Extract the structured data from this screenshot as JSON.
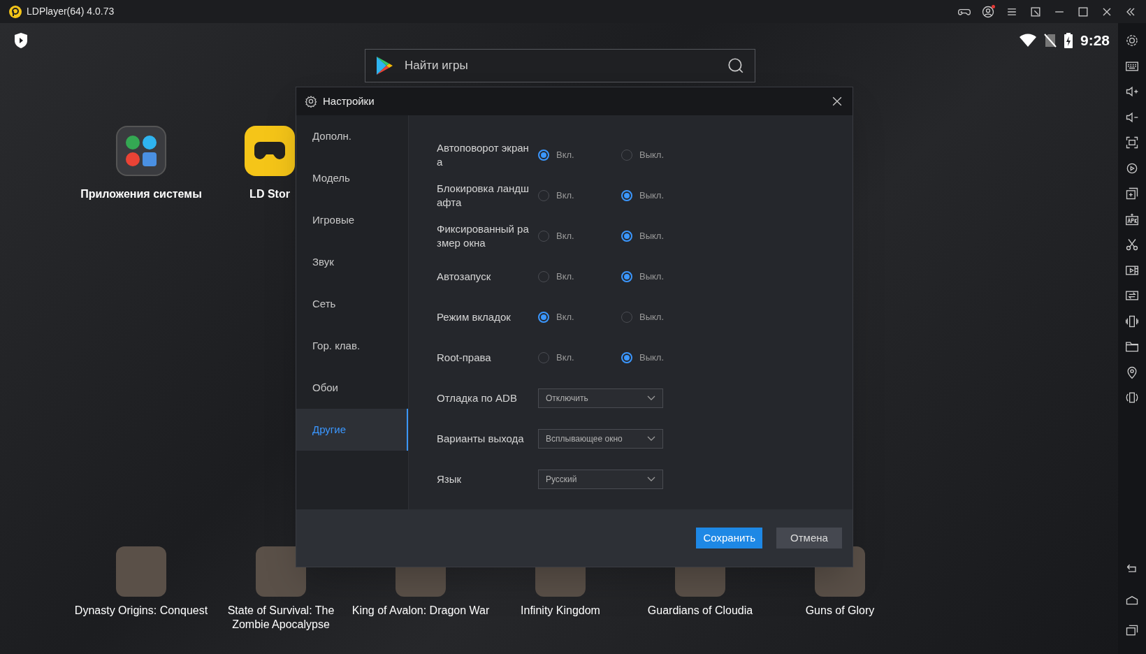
{
  "window": {
    "title": "LDPlayer(64) 4.0.73"
  },
  "status_bar": {
    "time": "9:28"
  },
  "search": {
    "placeholder": "Найти игры"
  },
  "desktop_icons": [
    {
      "label": "Приложения системы",
      "kind": "folder"
    },
    {
      "label": "LD Stor",
      "kind": "store"
    }
  ],
  "dock_apps": [
    {
      "label": "Dynasty Origins: Conquest"
    },
    {
      "label": "State of Survival: The Zombie Apocalypse"
    },
    {
      "label": "King of Avalon: Dragon War"
    },
    {
      "label": "Infinity Kingdom"
    },
    {
      "label": "Guardians of Cloudia"
    },
    {
      "label": "Guns of Glory"
    }
  ],
  "settings_dialog": {
    "title": "Настройки",
    "sidebar": {
      "items": [
        {
          "label": "Дополн.",
          "selected": false
        },
        {
          "label": "Модель",
          "selected": false
        },
        {
          "label": "Игровые",
          "selected": false
        },
        {
          "label": "Звук",
          "selected": false
        },
        {
          "label": "Сеть",
          "selected": false
        },
        {
          "label": "Гор. клав.",
          "selected": false
        },
        {
          "label": "Обои",
          "selected": false
        },
        {
          "label": "Другие",
          "selected": true
        }
      ]
    },
    "rows": [
      {
        "kind": "radio",
        "label": "Автоповорот экрана",
        "on_label": "Вкл.",
        "off_label": "Выкл.",
        "on": true
      },
      {
        "kind": "radio",
        "label": "Блокировка ландшафта",
        "on_label": "Вкл.",
        "off_label": "Выкл.",
        "on": false
      },
      {
        "kind": "radio",
        "label": "Фиксированный размер окна",
        "on_label": "Вкл.",
        "off_label": "Выкл.",
        "on": false
      },
      {
        "kind": "radio",
        "label": "Автозапуск",
        "on_label": "Вкл.",
        "off_label": "Выкл.",
        "on": false
      },
      {
        "kind": "radio",
        "label": "Режим вкладок",
        "on_label": "Вкл.",
        "off_label": "Выкл.",
        "on": true
      },
      {
        "kind": "radio",
        "label": "Root-права",
        "on_label": "Вкл.",
        "off_label": "Выкл.",
        "on": false
      },
      {
        "kind": "dropdown",
        "label": "Отладка по ADB",
        "value": "Отключить"
      },
      {
        "kind": "dropdown",
        "label": "Варианты выхода",
        "value": "Всплывающее окно"
      },
      {
        "kind": "dropdown",
        "label": "Язык",
        "value": "Русский"
      }
    ],
    "buttons": [
      {
        "kind": "primary",
        "label": "Сохранить"
      },
      {
        "kind": "secondary",
        "label": "Отмена"
      }
    ]
  }
}
